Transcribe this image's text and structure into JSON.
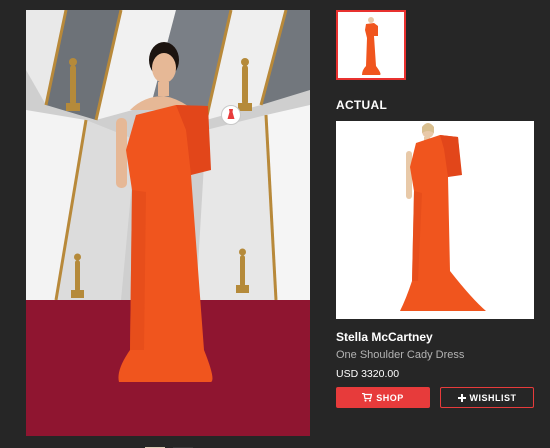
{
  "section": {
    "heading": "ACTUAL"
  },
  "product": {
    "brand": "Stella McCartney",
    "name": "One Shoulder Cady Dress",
    "price": "USD 3320.00"
  },
  "actions": {
    "shop_label": "SHOP",
    "shop_icon": "cart-icon",
    "wishlist_label": "WISHLIST",
    "wishlist_icon": "plus-icon"
  },
  "tag": {
    "icon": "dress-icon"
  },
  "colors": {
    "background": "#262626",
    "accent": "#e73b3b",
    "dress": "#f0551e",
    "carpet": "#8f1530"
  }
}
